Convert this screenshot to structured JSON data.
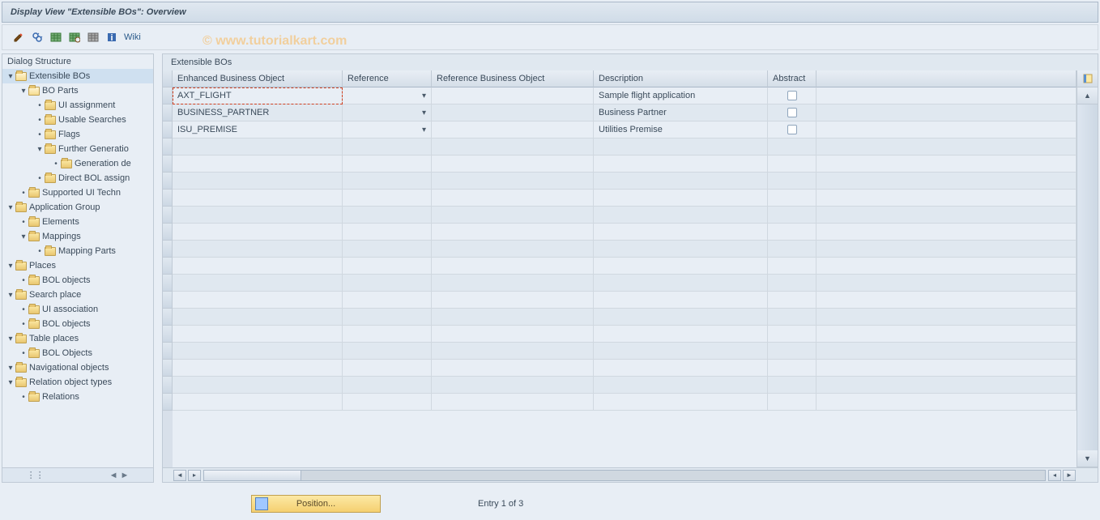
{
  "titlebar": "Display View \"Extensible BOs\": Overview",
  "watermark": "© www.tutorialkart.com",
  "toolbar": {
    "btn1_title": "Change",
    "btn2_title": "Glasses",
    "btn3_title": "Table",
    "btn4_title": "Table settings",
    "btn5_title": "Delimit",
    "wiki_label": "Wiki"
  },
  "sidebar": {
    "title": "Dialog Structure",
    "items": [
      {
        "indent": 0,
        "toggle": "▾",
        "label": "Extensible BOs",
        "open": true,
        "selected": true
      },
      {
        "indent": 1,
        "toggle": "▾",
        "label": "BO Parts",
        "open": true
      },
      {
        "indent": 2,
        "bullet": "•",
        "label": "UI assignment"
      },
      {
        "indent": 2,
        "bullet": "•",
        "label": "Usable Searches"
      },
      {
        "indent": 2,
        "bullet": "•",
        "label": "Flags"
      },
      {
        "indent": 2,
        "toggle": "▾",
        "label": "Further Generatio"
      },
      {
        "indent": 3,
        "bullet": "•",
        "label": "Generation de"
      },
      {
        "indent": 2,
        "bullet": "•",
        "label": "Direct BOL assign"
      },
      {
        "indent": 1,
        "bullet": "•",
        "label": "Supported UI Techn"
      },
      {
        "indent": 0,
        "toggle": "▾",
        "label": "Application Group"
      },
      {
        "indent": 1,
        "bullet": "•",
        "label": "Elements"
      },
      {
        "indent": 1,
        "toggle": "▾",
        "label": "Mappings"
      },
      {
        "indent": 2,
        "bullet": "•",
        "label": "Mapping Parts"
      },
      {
        "indent": 0,
        "toggle": "▾",
        "label": "Places"
      },
      {
        "indent": 1,
        "bullet": "•",
        "label": "BOL objects"
      },
      {
        "indent": 0,
        "toggle": "▾",
        "label": "Search place"
      },
      {
        "indent": 1,
        "bullet": "•",
        "label": "UI association"
      },
      {
        "indent": 1,
        "bullet": "•",
        "label": "BOL objects"
      },
      {
        "indent": 0,
        "toggle": "▾",
        "label": "Table places"
      },
      {
        "indent": 1,
        "bullet": "•",
        "label": "BOL Objects"
      },
      {
        "indent": 0,
        "toggle": "▾",
        "label": "Navigational objects"
      },
      {
        "indent": 0,
        "toggle": "▾",
        "label": "Relation object types"
      },
      {
        "indent": 1,
        "bullet": "•",
        "label": "Relations"
      }
    ]
  },
  "content": {
    "title": "Extensible BOs",
    "columns": {
      "ebo": "Enhanced Business Object",
      "ref": "Reference",
      "rbo": "Reference Business Object",
      "desc": "Description",
      "abs": "Abstract"
    },
    "rows": [
      {
        "ebo": "AXT_FLIGHT",
        "ref": "",
        "rbo": "",
        "desc": "Sample flight application",
        "abs": false,
        "active": true
      },
      {
        "ebo": "BUSINESS_PARTNER",
        "ref": "",
        "rbo": "",
        "desc": "Business Partner",
        "abs": false
      },
      {
        "ebo": "ISU_PREMISE",
        "ref": "",
        "rbo": "",
        "desc": "Utilities Premise",
        "abs": false
      }
    ],
    "empty_rows": 16
  },
  "footer": {
    "position_btn": "Position...",
    "entry_text": "Entry 1 of 3"
  }
}
